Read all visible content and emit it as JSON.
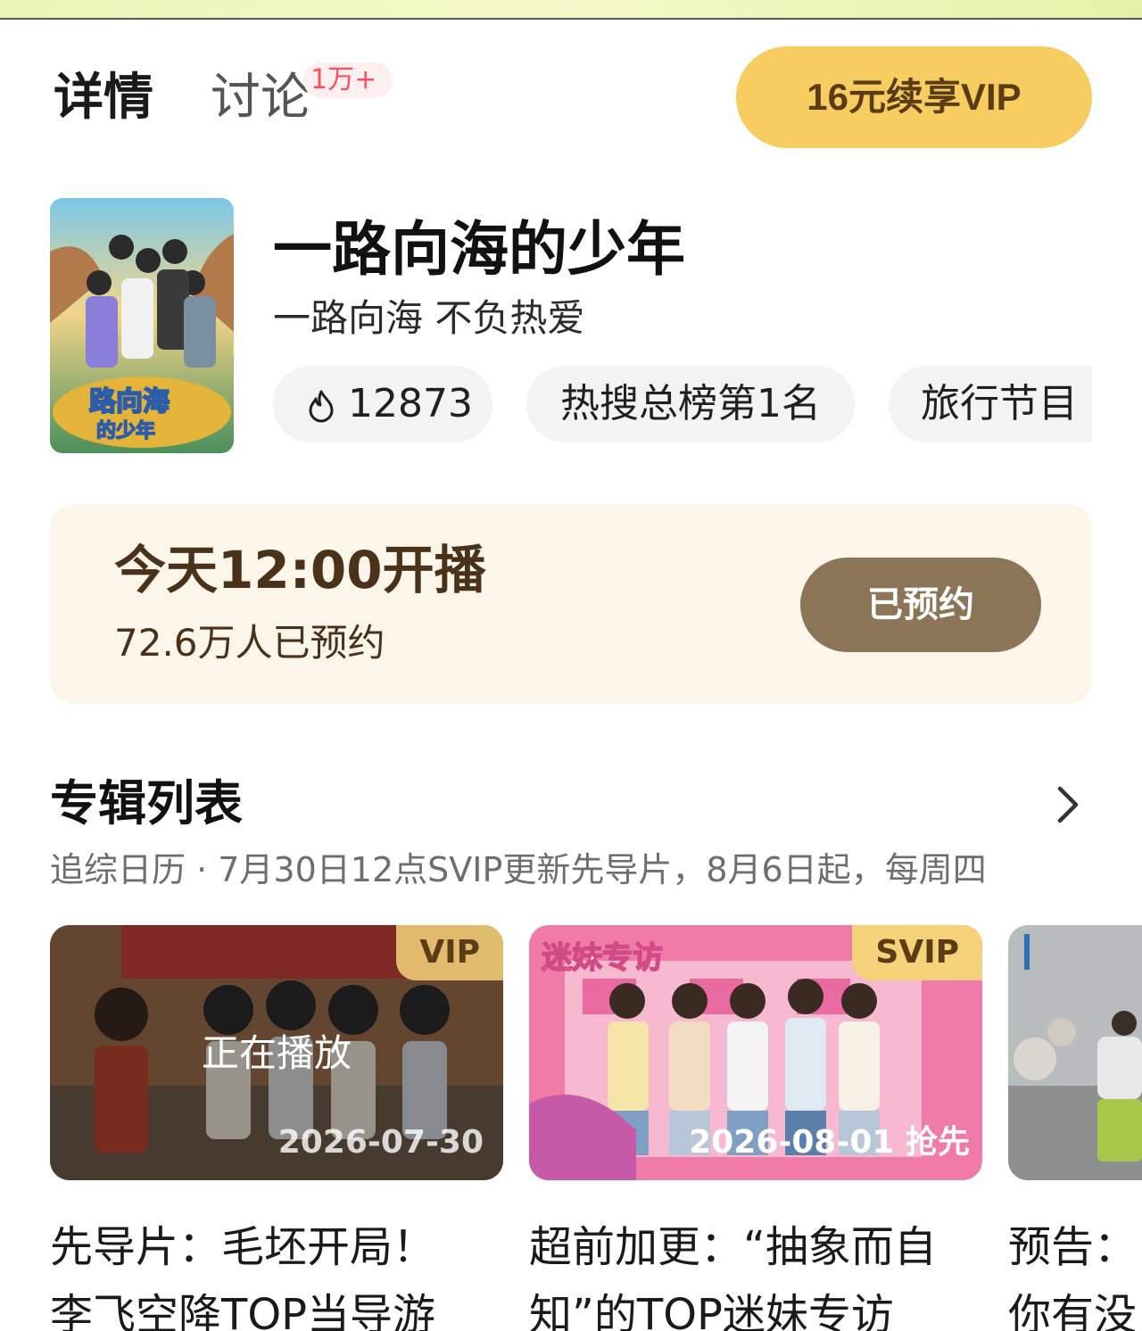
{
  "tabs": {
    "details_label": "详情",
    "discuss_label": "讨论",
    "discuss_badge": "1万+"
  },
  "vip_button": {
    "label": "16元续享VIP"
  },
  "show": {
    "title": "一路向海的少年",
    "slogan": "一路向海 不负热爱",
    "tags": {
      "heat_icon": "flame-icon",
      "heat_value": "12873",
      "rank": "热搜总榜第1名",
      "genre": "旅行节目"
    }
  },
  "schedule": {
    "time_text": "今天12:00开播",
    "reservation_count": "72.6万人已预约",
    "reserved_button": "已预约"
  },
  "album": {
    "title": "专辑列表",
    "arrow_icon": "chevron-right-icon",
    "subtitle": "追综日历 · 7月30日12点SVIP更新先导片，8月6日起，每周四",
    "episodes": [
      {
        "badge": "VIP",
        "status": "正在播放",
        "date": "2026-07-30",
        "title_line1": "先导片：毛坯开局！",
        "title_line2": "李飞空降TOP当导游"
      },
      {
        "badge": "SVIP",
        "date": "2026-08-01 抢先",
        "overlay_text": "迷妹专访",
        "title_line1": "超前加更：“抽象而自",
        "title_line2": "知”的TOP迷妹专访"
      },
      {
        "title_line1": "预告：",
        "title_line2": "你有没"
      }
    ]
  },
  "colors": {
    "vip_gold": "#f7cd62",
    "reserve_brown": "#8c7456",
    "card_cream": "#fbf5ea",
    "badge_red": "#ff4d5e"
  }
}
